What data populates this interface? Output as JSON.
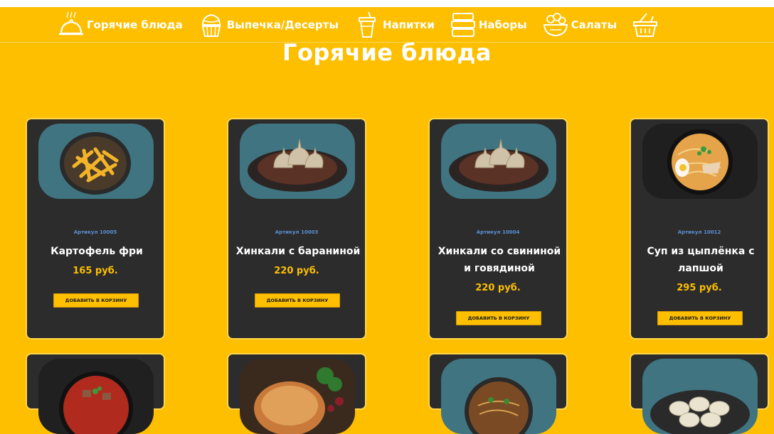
{
  "nav": {
    "items": [
      {
        "label": "Горячие блюда",
        "icon": "cloche-icon"
      },
      {
        "label": "Выпечка/Десерты",
        "icon": "cupcake-icon"
      },
      {
        "label": "Напитки",
        "icon": "drink-cup-icon"
      },
      {
        "label": "Наборы",
        "icon": "lunchbox-icon"
      },
      {
        "label": "Салаты",
        "icon": "salad-bowl-icon"
      },
      {
        "label": "",
        "icon": "basket-icon"
      }
    ]
  },
  "page": {
    "title": "Горячие блюда"
  },
  "products": [
    {
      "sku": "Артикул 10005",
      "name": "Картофель фри",
      "price": "165 руб.",
      "button": "ДОБАВИТЬ В КОРЗИНУ"
    },
    {
      "sku": "Артикул 10003",
      "name": "Хинкали с бараниной",
      "price": "220 руб.",
      "button": "ДОБАВИТЬ В КОРЗИНУ"
    },
    {
      "sku": "Артикул 10004",
      "name": "Хинкали со свининой и говядиной",
      "price": "220 руб.",
      "button": "ДОБАВИТЬ В КОРЗИНУ"
    },
    {
      "sku": "Артикул 10012",
      "name": "Суп из цыплёнка с лапшой",
      "price": "295 руб.",
      "button": "ДОБАВИТЬ В КОРЗИНУ"
    }
  ],
  "colors": {
    "accent": "#fdbf00",
    "card": "#2c2c2c",
    "card_border": "#ffd64d",
    "sku": "#5a8fd0"
  }
}
